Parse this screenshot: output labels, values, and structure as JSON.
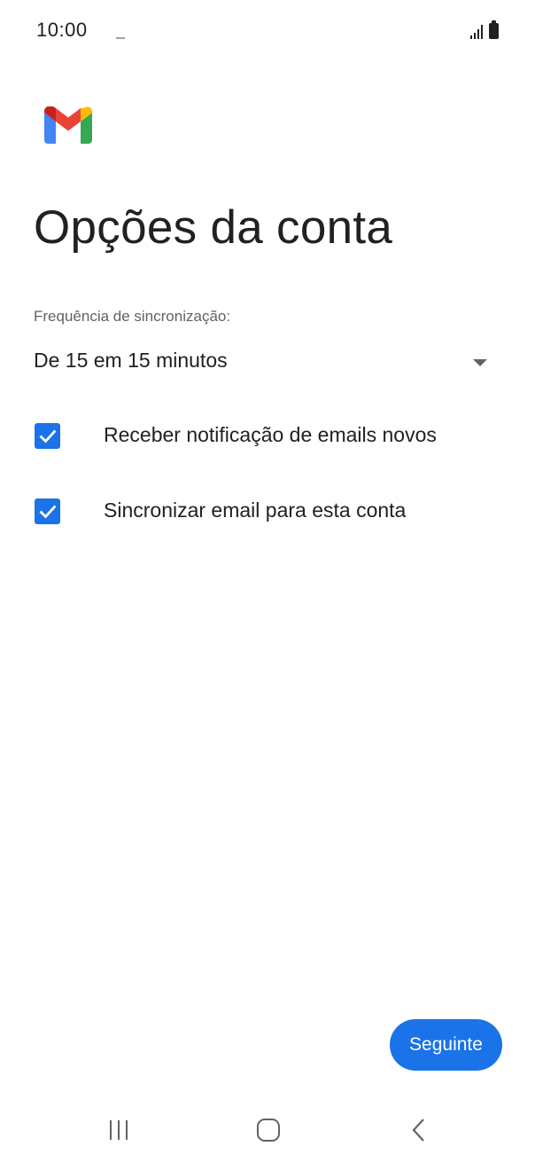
{
  "status_bar": {
    "time": "10:00"
  },
  "app": {
    "logo_icon": "gmail-logo-icon",
    "colors": {
      "accent": "#1a73e8",
      "logo_red": "#ea4335",
      "logo_blue": "#4285f4",
      "logo_green": "#34a853",
      "logo_yellow": "#fbbc04",
      "logo_dark_red": "#c5221f"
    }
  },
  "page": {
    "title": "Opções da conta"
  },
  "sync": {
    "label": "Frequência de sincronização:",
    "selected_value": "De 15 em 15 minutos"
  },
  "options": [
    {
      "label": "Receber notificação de emails novos",
      "checked": true
    },
    {
      "label": "Sincronizar email para esta conta",
      "checked": true
    }
  ],
  "actions": {
    "next_label": "Seguinte"
  },
  "nav_bar": {
    "items": [
      "recent-apps-icon",
      "home-icon",
      "back-icon"
    ]
  }
}
